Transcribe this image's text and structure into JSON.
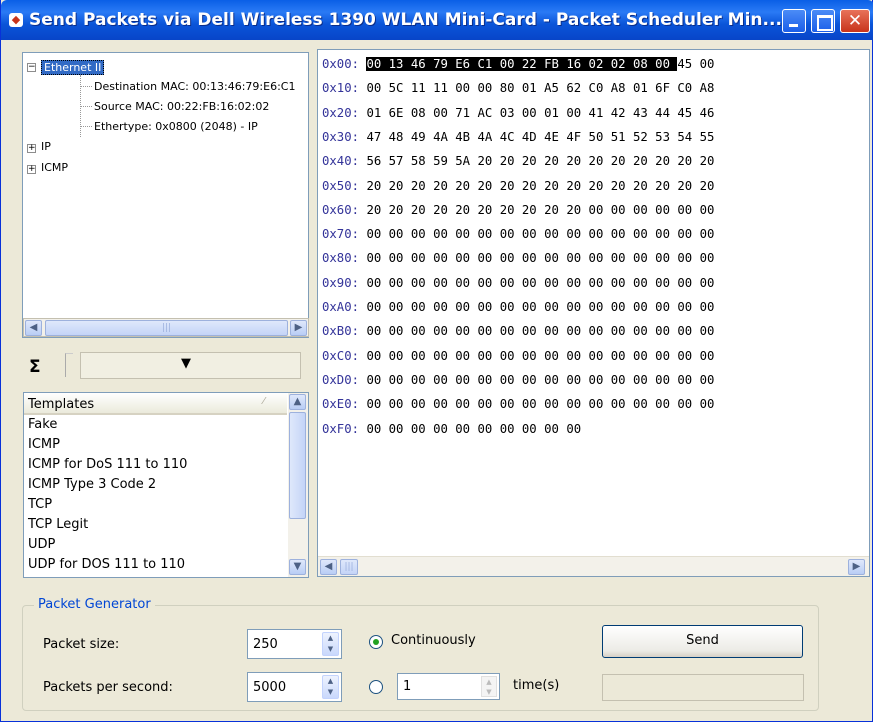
{
  "window": {
    "title": "Send Packets via  Dell Wireless 1390 WLAN Mini-Card - Packet Scheduler Min...",
    "icon": "app-icon"
  },
  "tree": {
    "root": "Ethernet II",
    "children": [
      "Destination MAC: 00:13:46:79:E6:C1",
      "Source MAC: 00:22:FB:16:02:02",
      "Ethertype: 0x0800 (2048) - IP"
    ],
    "other_nodes": [
      "IP",
      "ICMP"
    ]
  },
  "sigma": {
    "symbol": "Σ",
    "combo_arrow": "▼"
  },
  "templates": {
    "header": "Templates",
    "items": [
      "Fake",
      "ICMP",
      "ICMP for DoS 111 to 110",
      "ICMP Type 3 Code 2",
      "TCP",
      "TCP Legit",
      "UDP",
      "UDP for DOS 111 to 110"
    ]
  },
  "hex": {
    "highlight_count": 14,
    "rows": [
      {
        "addr": "0x00:",
        "bytes": "00 13 46 79 E6 C1 00 22 FB 16 02 02 08 00 45 00"
      },
      {
        "addr": "0x10:",
        "bytes": "00 5C 11 11 00 00 80 01 A5 62 C0 A8 01 6F C0 A8"
      },
      {
        "addr": "0x20:",
        "bytes": "01 6E 08 00 71 AC 03 00 01 00 41 42 43 44 45 46"
      },
      {
        "addr": "0x30:",
        "bytes": "47 48 49 4A 4B 4A 4C 4D 4E 4F 50 51 52 53 54 55"
      },
      {
        "addr": "0x40:",
        "bytes": "56 57 58 59 5A 20 20 20 20 20 20 20 20 20 20 20"
      },
      {
        "addr": "0x50:",
        "bytes": "20 20 20 20 20 20 20 20 20 20 20 20 20 20 20 20"
      },
      {
        "addr": "0x60:",
        "bytes": "20 20 20 20 20 20 20 20 20 20 00 00 00 00 00 00"
      },
      {
        "addr": "0x70:",
        "bytes": "00 00 00 00 00 00 00 00 00 00 00 00 00 00 00 00"
      },
      {
        "addr": "0x80:",
        "bytes": "00 00 00 00 00 00 00 00 00 00 00 00 00 00 00 00"
      },
      {
        "addr": "0x90:",
        "bytes": "00 00 00 00 00 00 00 00 00 00 00 00 00 00 00 00"
      },
      {
        "addr": "0xA0:",
        "bytes": "00 00 00 00 00 00 00 00 00 00 00 00 00 00 00 00"
      },
      {
        "addr": "0xB0:",
        "bytes": "00 00 00 00 00 00 00 00 00 00 00 00 00 00 00 00"
      },
      {
        "addr": "0xC0:",
        "bytes": "00 00 00 00 00 00 00 00 00 00 00 00 00 00 00 00"
      },
      {
        "addr": "0xD0:",
        "bytes": "00 00 00 00 00 00 00 00 00 00 00 00 00 00 00 00"
      },
      {
        "addr": "0xE0:",
        "bytes": "00 00 00 00 00 00 00 00 00 00 00 00 00 00 00 00"
      },
      {
        "addr": "0xF0:",
        "bytes": "00 00 00 00 00 00 00 00 00 00"
      }
    ]
  },
  "generator": {
    "legend": "Packet Generator",
    "packet_size_label": "Packet size:",
    "packet_size_value": "250",
    "pps_label": "Packets per second:",
    "pps_value": "5000",
    "continuously_label": "Continuously",
    "count_value": "1",
    "times_label": "time(s)",
    "send_label": "Send",
    "mode": "continuously"
  }
}
